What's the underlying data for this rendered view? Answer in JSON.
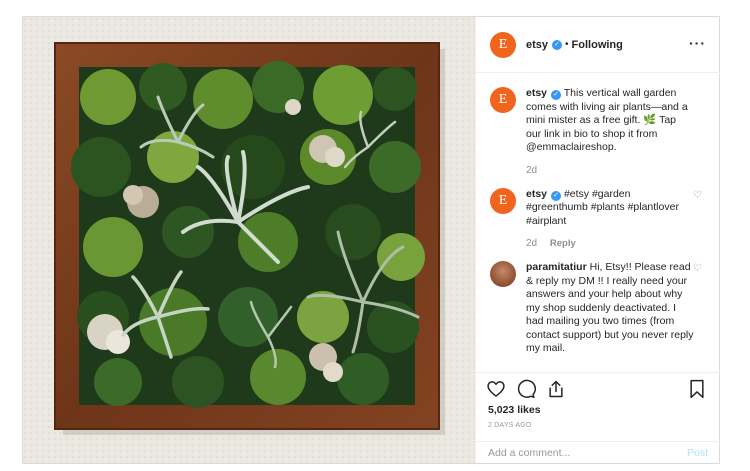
{
  "post": {
    "username": "etsy",
    "avatar_letter": "E",
    "following_label": "Following",
    "separator": "•",
    "more_label": "···"
  },
  "comments": [
    {
      "username": "etsy",
      "avatar_letter": "E",
      "text": "This vertical wall garden comes with living air plants—and a mini mister as a free gift. 🌿 Tap our link in bio to shop it from @emmaclaireshop.",
      "time": "2d"
    },
    {
      "username": "etsy",
      "avatar_letter": "E",
      "text": "#etsy #garden #greenthumb #plants #plantlover #airplant",
      "time": "2d",
      "reply_label": "Reply"
    },
    {
      "username": "paramitatiur",
      "text": "Hi, Etsy!! Please read & reply my DM !! I really need your answers and your help about why my shop suddenly deactivated. I had mailing you two times (from contact support) but you never reply my mail."
    }
  ],
  "likes": "5,023 likes",
  "posted_ago": "2 DAYS AGO",
  "comment_box": {
    "placeholder": "Add a comment...",
    "post_label": "Post"
  },
  "colors": {
    "etsy_orange": "#f1641e",
    "verified_blue": "#3897f0",
    "frame_wood": "#7a3d1e",
    "moss_green": "#3f6b2a"
  },
  "icons": [
    "heart-icon",
    "comment-icon",
    "share-icon",
    "bookmark-icon",
    "verified-badge-icon",
    "more-options-icon"
  ]
}
